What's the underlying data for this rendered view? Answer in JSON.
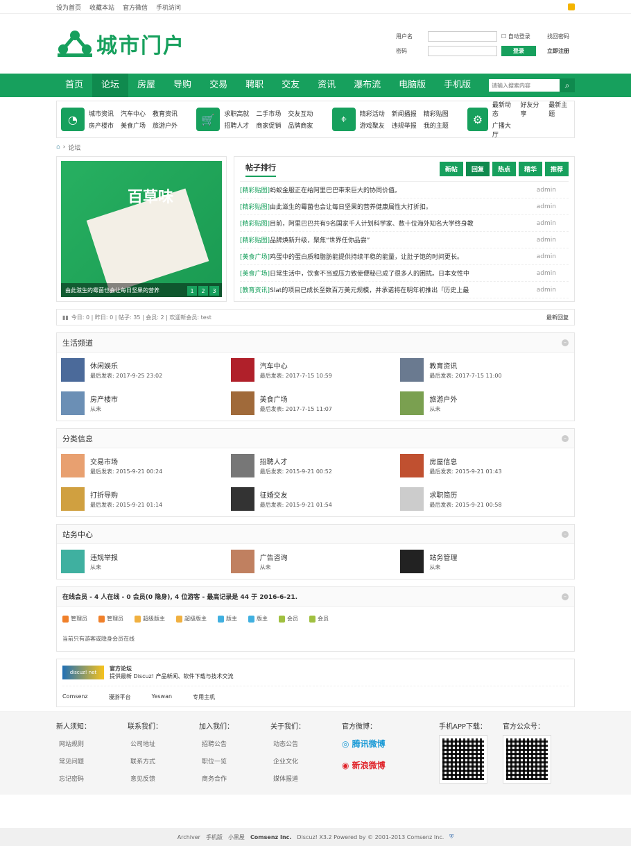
{
  "topbar": {
    "home": "设为首页",
    "fav": "收藏本站",
    "wechat": "官方微信",
    "mobile": "手机访问"
  },
  "header": {
    "logo": "城市门户",
    "user_label": "用户名",
    "pass_label": "密码",
    "auto": "自动登录",
    "find": "找回密码",
    "login": "登录",
    "register": "立即注册"
  },
  "nav": {
    "items": [
      "首页",
      "论坛",
      "房屋",
      "导购",
      "交易",
      "聘职",
      "交友",
      "资讯",
      "瀑布流",
      "电脑版",
      "手机版"
    ],
    "search_placeholder": "请输入搜索内容"
  },
  "quick": [
    {
      "links": [
        "城市资讯",
        "汽车中心",
        "教育资讯",
        "房产楼市",
        "美食广场",
        "旅游户外"
      ]
    },
    {
      "links": [
        "求职高就",
        "二手市场",
        "交友互动",
        "招聘人才",
        "商家促销",
        "品牌商家"
      ]
    },
    {
      "links": [
        "精彩活动",
        "新闻播报",
        "精彩贴图",
        "游戏聚友",
        "违规举报",
        "我的主题"
      ]
    },
    {
      "links": [
        "最新动态",
        "好友分享",
        "最新主题",
        "广播大厅"
      ]
    }
  ],
  "crumb": "论坛",
  "slider": {
    "caption": "由此滋生的霉菌也会让每日坚果的营养",
    "pages": [
      "1",
      "2",
      "3"
    ],
    "brand": "百草味"
  },
  "posts": {
    "title": "帖子排行",
    "tabs": [
      "新帖",
      "回复",
      "热点",
      "精华",
      "推荐"
    ],
    "items": [
      {
        "cat": "[精彩贴图]",
        "text": "蚂蚁金服正在给阿里巴巴带来巨大的协同价值。",
        "author": "admin"
      },
      {
        "cat": "[精彩贴图]",
        "text": "由此滋生的霉菌也会让每日坚果的营养健康属性大打折扣。",
        "author": "admin"
      },
      {
        "cat": "[精彩贴图]",
        "text": "目前，阿里巴巴共有9名国家千人计划科学家、数十位海外知名大学终身教",
        "author": "admin"
      },
      {
        "cat": "[精彩贴图]",
        "text": "品牌焕新升级，聚焦“世界任你品尝”",
        "author": "admin"
      },
      {
        "cat": "[美食广场]",
        "text": "鸡蛋中的蛋白质和脂肪能提供持续平稳的能量，让肚子饱的时间更长。",
        "author": "admin"
      },
      {
        "cat": "[美食广场]",
        "text": "日常生活中，饮食不当或压力致使便秘已成了很多人的困扰。日本女性中",
        "author": "admin"
      },
      {
        "cat": "[教育资讯]",
        "text": "Slat的项目已成长至数百万美元规模，并承诺将在明年初推出「历史上最",
        "author": "admin"
      }
    ]
  },
  "stats": {
    "text": "今日: 0 | 昨日: 0 | 帖子: 35 | 会员: 2 | 欢迎新会员: test",
    "right": "最新回复"
  },
  "life": {
    "title": "生活频道",
    "items": [
      {
        "name": "休闲娱乐",
        "meta": "最后发表: 2017-9-25 23:02",
        "color": "#4b6a9a"
      },
      {
        "name": "汽车中心",
        "meta": "最后发表: 2017-7-15 10:59",
        "color": "#b0202a"
      },
      {
        "name": "教育资讯",
        "meta": "最后发表: 2017-7-15 11:00",
        "color": "#6a7a90"
      },
      {
        "name": "房产楼市",
        "meta": "从未",
        "color": "#6b8fb5"
      },
      {
        "name": "美食广场",
        "meta": "最后发表: 2017-7-15 11:07",
        "color": "#a06a3a"
      },
      {
        "name": "旅游户外",
        "meta": "从未",
        "color": "#7aa050"
      }
    ]
  },
  "classify": {
    "title": "分类信息",
    "items": [
      {
        "name": "交易市场",
        "meta": "最后发表: 2015-9-21 00:24",
        "color": "#e8a070"
      },
      {
        "name": "招聘人才",
        "meta": "最后发表: 2015-9-21 00:52",
        "color": "#777"
      },
      {
        "name": "房屋信息",
        "meta": "最后发表: 2015-9-21 01:43",
        "color": "#c05030"
      },
      {
        "name": "打折导购",
        "meta": "最后发表: 2015-9-21 01:14",
        "color": "#d0a040"
      },
      {
        "name": "征婚交友",
        "meta": "最后发表: 2015-9-21 01:54",
        "color": "#333"
      },
      {
        "name": "求职简历",
        "meta": "最后发表: 2015-9-21 00:58",
        "color": "#ccc"
      }
    ]
  },
  "station": {
    "title": "站务中心",
    "items": [
      {
        "name": "违规举报",
        "meta": "从未",
        "color": "#3fb0a0"
      },
      {
        "name": "广告咨询",
        "meta": "从未",
        "color": "#c08060"
      },
      {
        "name": "站务管理",
        "meta": "从未",
        "color": "#222"
      }
    ]
  },
  "online": {
    "title": "在线会员 - 4 人在线 - 0 会员(0 隐身), 4 位游客 - 最高记录是 44 于 2016-6-21.",
    "legend": [
      {
        "label": "管理员",
        "color": "#f0802a"
      },
      {
        "label": "管理员",
        "color": "#f0802a"
      },
      {
        "label": "超级版主",
        "color": "#f0b040"
      },
      {
        "label": "超级版主",
        "color": "#f0b040"
      },
      {
        "label": "版主",
        "color": "#40b0e0"
      },
      {
        "label": "版主",
        "color": "#40b0e0"
      },
      {
        "label": "会员",
        "color": "#a0c040"
      },
      {
        "label": "会员",
        "color": "#a0c040"
      }
    ],
    "note": "当前只有游客或隐身会员在线"
  },
  "links": {
    "logo": "discuz! net",
    "name": "官方论坛",
    "desc": "提供最新 Discuz! 产品新闻、软件下载与技术交流",
    "items": [
      "Comsenz",
      "漫游平台",
      "Yeswan",
      "专用主机"
    ]
  },
  "footer": {
    "cols": [
      {
        "title": "新人须知：",
        "items": [
          "网站规则",
          "常见问题",
          "忘记密码"
        ]
      },
      {
        "title": "联系我们：",
        "items": [
          "公司地址",
          "联系方式",
          "意见反馈"
        ]
      },
      {
        "title": "加入我们：",
        "items": [
          "招聘公告",
          "职位一览",
          "商务合作"
        ]
      },
      {
        "title": "关于我们：",
        "items": [
          "动态公告",
          "企业文化",
          "媒体报道"
        ]
      }
    ],
    "weibo_title": "官方微博：",
    "tencent": "腾讯微博",
    "sina": "新浪微博",
    "app": "手机APP下载：",
    "mp": "官方公众号："
  },
  "copyright": {
    "a": "Archiver",
    "b": "手机版",
    "c": "小黑屋",
    "d": "Comsenz Inc.",
    "e": "Discuz! X3.2 Powered by © 2001-2013 Comsenz Inc."
  }
}
